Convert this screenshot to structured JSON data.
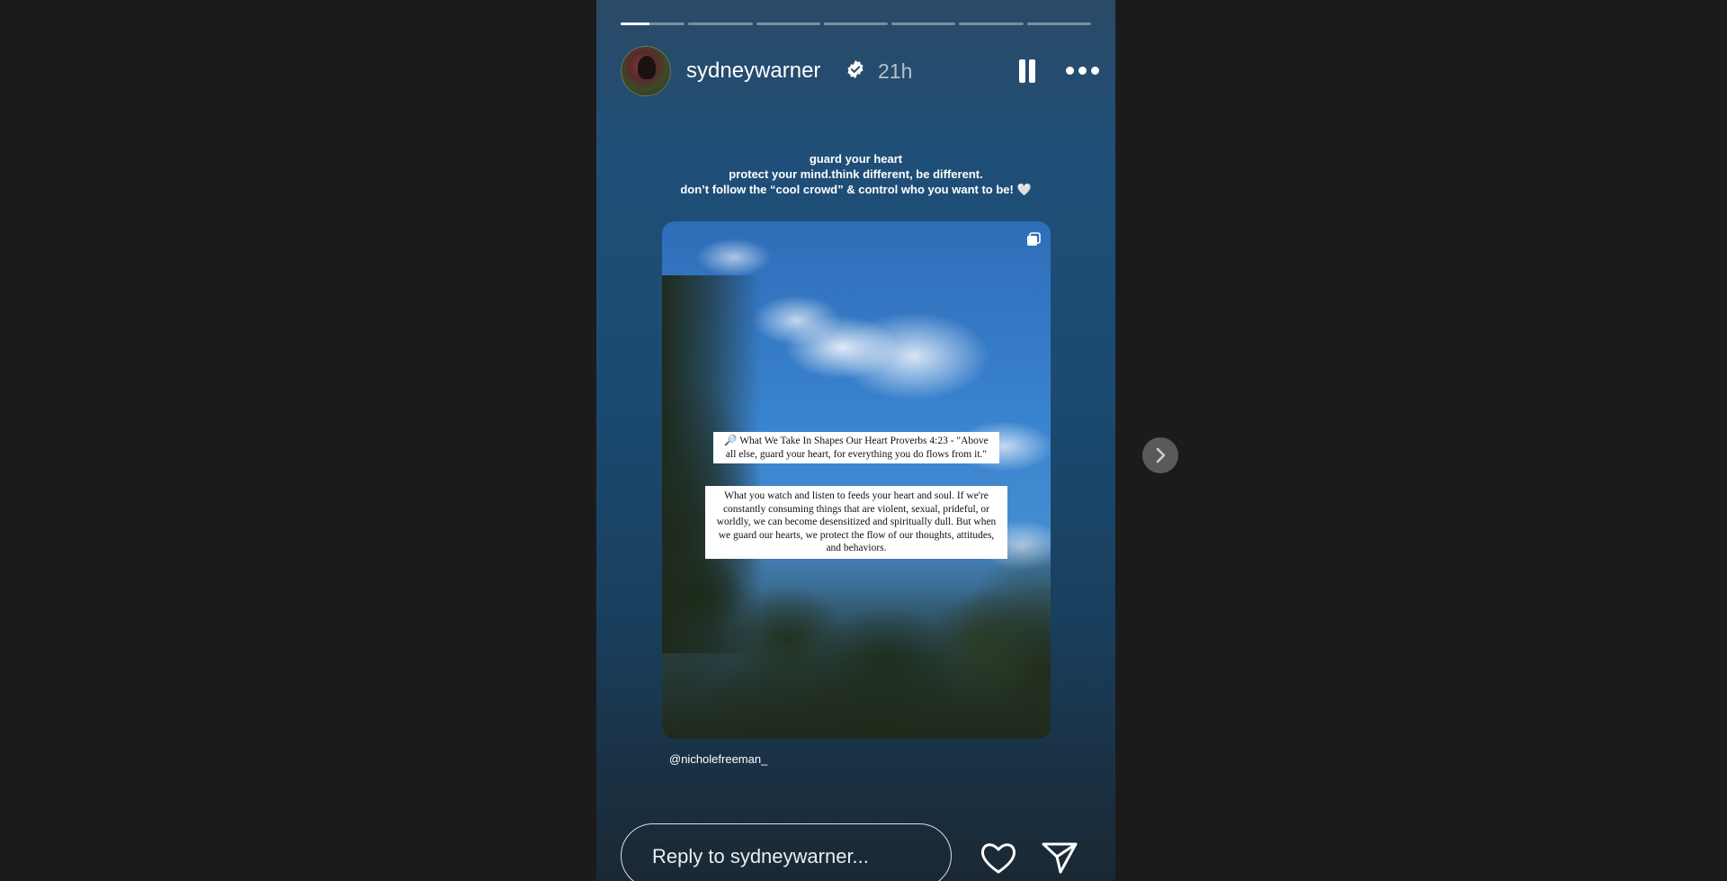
{
  "story": {
    "progress_segments": 7,
    "active_segment": 0,
    "active_progress": 0.45,
    "header": {
      "username": "sydneywarner",
      "verified_icon": "verified-badge-icon",
      "time": "21h",
      "pause_icon": "pause-icon",
      "more_icon": "more-options-icon"
    },
    "caption": {
      "line1": "guard your heart",
      "line2": "protect your mind.think different, be different.",
      "line3": "don’t follow the “cool crowd” & control who you want to be! 🤍"
    },
    "shared_post": {
      "multi_icon": "carousel-icon",
      "quote": "🔎 What We Take In Shapes Our Heart Proverbs 4:23 - \"Above all else, guard your heart, for everything you do flows from it.\"",
      "body": "What you watch and listen to feeds your heart and soul. If we're constantly consuming things that are violent, sexual, prideful, or worldly, we can become desensitized and spiritually dull. But when we guard our hearts, we protect the flow of our thoughts, attitudes, and behaviors."
    },
    "mention": "@nicholefreeman_",
    "footer": {
      "reply_placeholder": "Reply to sydneywarner...",
      "like_icon": "heart-icon",
      "share_icon": "send-icon"
    }
  },
  "navigation": {
    "next_icon": "chevron-right-icon"
  },
  "colors": {
    "page_background": "#1b1b1b",
    "story_gradient_top": "#2a4a66",
    "story_gradient_bottom": "#1a2833",
    "next_button": "#5a5a5a"
  }
}
